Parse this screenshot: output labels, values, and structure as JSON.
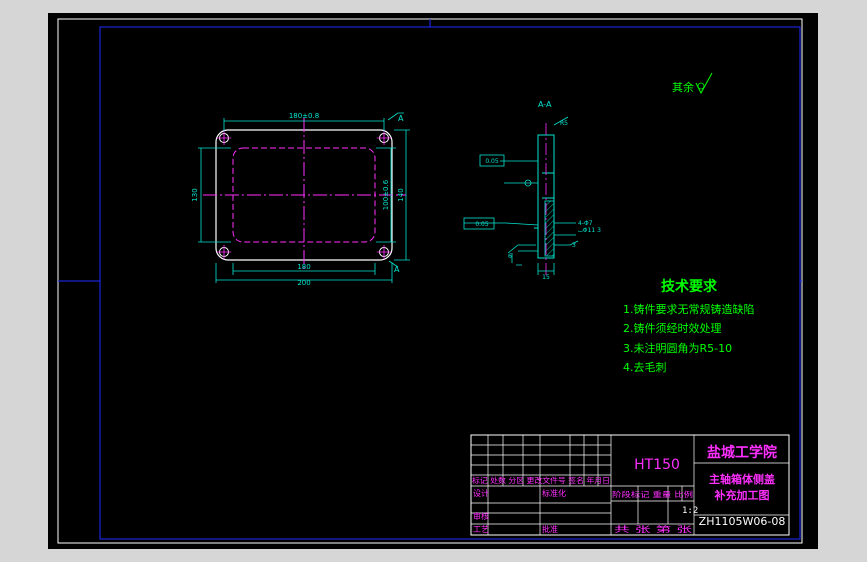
{
  "colors": {
    "background": "#000000",
    "frame": "#1e2bff",
    "outer_border": "#ffffff",
    "part_outline": "#ffffff",
    "dimension": "#00e5d0",
    "dimension_alt": "#00c800",
    "centerline": "#ff30ff",
    "section": "#00e5d0",
    "tech_text": "#00ff00",
    "title_text": "#ff30ff",
    "table_line": "#ffffff"
  },
  "roughness_note": "其余",
  "section_label": "A-A",
  "section_marker": "A",
  "dims": {
    "width_top": "180±0.8",
    "height_left": "130",
    "height_right_1": "100±0.6",
    "height_right_2": "140",
    "width_bottom_1": "180",
    "width_bottom_2": "200",
    "section_top": "R5",
    "section_tol_1": "0.05",
    "section_tol_2": "0.05",
    "section_right_1": "4-Φ7",
    "section_right_2": "⌴Φ11 3",
    "section_right_3": "3",
    "section_bottom": "15",
    "section_left": "6"
  },
  "tech_requirements": {
    "title": "技术要求",
    "items": [
      "1.铸件要求无常规铸造缺陷",
      "2.铸件须经时效处理",
      "3.未注明圆角为R5-10",
      "4.去毛刺"
    ]
  },
  "title_block": {
    "material": "HT150",
    "school": "盐城工学院",
    "part_name_1": "主轴箱体侧盖",
    "part_name_2": "补充加工图",
    "header_row": "标记 处数 分区 更改文件号 签名 年月日",
    "design": "设计",
    "standardize": "标准化",
    "review": "审核",
    "process": "工艺",
    "approve": "批准",
    "stage_header": "阶段标记 重量 比例",
    "scale": "1:2",
    "sheets": "共  张 第  张",
    "drawing_no": "ZH1105W06-08"
  }
}
